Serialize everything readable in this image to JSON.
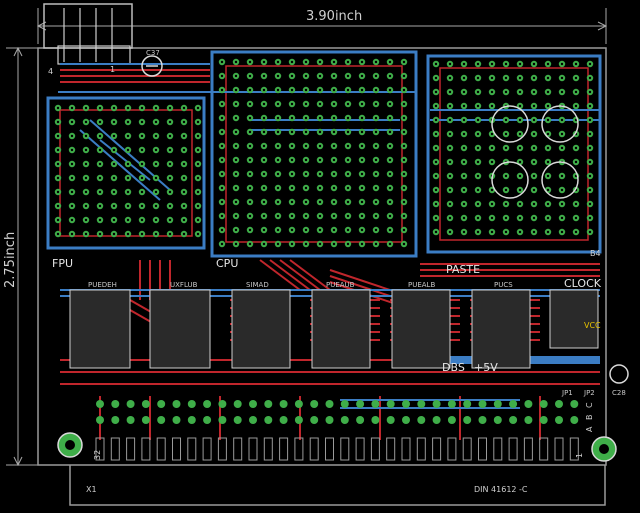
{
  "dimensions": {
    "width_label": "3.90inch",
    "height_label": "2.75inch"
  },
  "silkscreen": {
    "fpu": "FPU",
    "cpu": "CPU",
    "paste": "PASTE",
    "clock": "CLOCK",
    "vcc": "VCC",
    "dbs": "DBS",
    "plus5v": "+5V",
    "connector": "X1",
    "connector_std": "DIN 41612 -C",
    "pin_32": "32",
    "pin_1": "1",
    "pin_4": "4",
    "pin_1_top": "1",
    "row_labels": [
      "A",
      "B",
      "C"
    ],
    "b4": "B4",
    "ic_labels": [
      "PUEDEH",
      "UXFLUB",
      "SIMAD",
      "PUEAUB",
      "PUEALB",
      "PUCS"
    ],
    "caps": [
      "C37",
      "C28"
    ],
    "jumpers": [
      "JP1",
      "JP2"
    ]
  },
  "colors": {
    "background": "#000000",
    "top_copper": "#c0262c",
    "bottom_copper": "#3b7dc4",
    "pad": "#3fae49",
    "silk": "#d9d9d9",
    "outline": "#9a9a9a"
  }
}
